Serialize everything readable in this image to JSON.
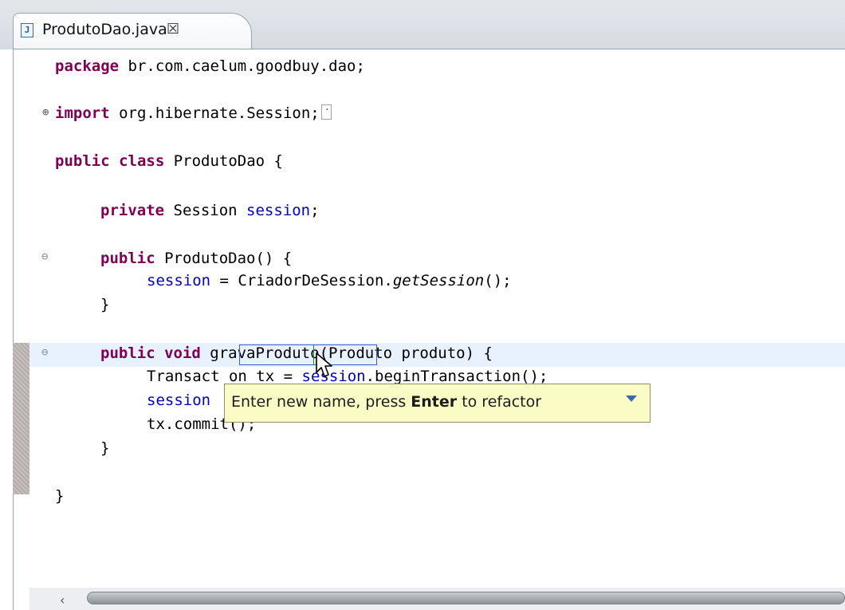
{
  "tab": {
    "icon": "java-file-icon",
    "icon_glyph": "J",
    "title": "ProdutoDao.java",
    "close_glyph": "☒"
  },
  "code": {
    "package_kw": "package",
    "package_name": " br.com.caelum.goodbuy.dao;",
    "import_kw": "import",
    "import_name": " org.hibernate.Session;",
    "class_mods": "public class",
    "class_name": " ProdutoDao {",
    "field_mod": "private",
    "field_type": " Session ",
    "field_name": "session",
    "field_end": ";",
    "ctor_mod": "public",
    "ctor_sig": " ProdutoDao() {",
    "ctor_body_field": "session",
    "ctor_body_mid": " = CriadorDeSession.",
    "ctor_body_call": "getSession",
    "ctor_body_end": "();",
    "ctor_close": "}",
    "method_mods": "public void",
    "method_name": "gravaProduto",
    "method_params": "(Produto produto) {",
    "tx_line_a": "Transact",
    "tx_line_b": "on tx =",
    "tx_field": "session",
    "tx_line_c": ".beginTransaction();",
    "save_field": "session",
    "commit_line": "tx.commit();",
    "method_close": "}",
    "class_close": "}"
  },
  "hint": {
    "prefix": "Enter new name, press ",
    "key": "Enter",
    "suffix": " to refactor"
  },
  "colors": {
    "keyword": "#7f0055",
    "field": "#0000c0",
    "tooltip_bg": "#fbfbc6",
    "current_line": "#e8f2fe"
  }
}
